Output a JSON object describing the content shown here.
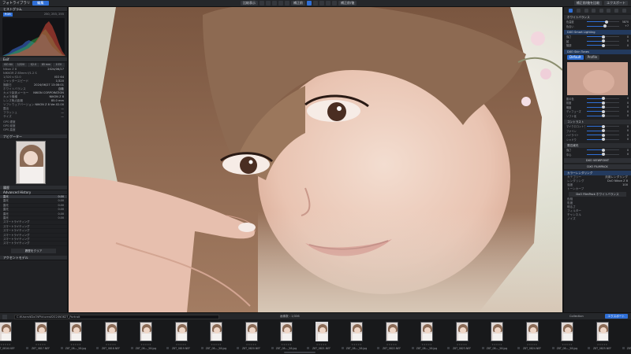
{
  "topbar": {
    "library_label": "フォトライブラリ",
    "edit_label": "編集",
    "compare_label": "比較表示",
    "before_label": "補正前",
    "after_label": "補正前/後",
    "export_label": "エクスポート",
    "ai_label": "補正前/後を比較"
  },
  "left": {
    "histogram_title": "ヒストグラム",
    "rgb_label": "RGB",
    "histo_values": "250, 253, 255",
    "exif_title": "Exif",
    "info_rows": [
      {
        "k": "Nikon Z 8",
        "v": "2024/06/27"
      },
      {
        "k": "NIKKOR Z 85mm f/1.2 S",
        "v": ""
      },
      {
        "k": "1/320 s  f/2.0",
        "v": "ISO 64"
      },
      {
        "k": "シャッタースピード",
        "v": "1/320"
      },
      {
        "k": "撮影日",
        "v": "2024/06/27 13:08:01"
      },
      {
        "k": "ホワイトバランス",
        "v": "自動"
      },
      {
        "k": "カメラ製造メーカー",
        "v": "NIKON CORPORATION"
      },
      {
        "k": "カメラ機種",
        "v": "NIKON Z 8"
      },
      {
        "k": "レンズ焦点距離",
        "v": "85.0 mm"
      },
      {
        "k": "ソフトウェアバージョン",
        "v": "NIKON Z 8 Ver.02.00"
      },
      {
        "k": "露出",
        "v": "—"
      },
      {
        "k": "フラッシュ",
        "v": "—"
      },
      {
        "k": "サイズ",
        "v": "—"
      }
    ],
    "gps_rows": [
      {
        "k": "GPS 緯度",
        "v": ""
      },
      {
        "k": "GPS 経度",
        "v": ""
      },
      {
        "k": "GPS 高度",
        "v": ""
      }
    ],
    "buttons": [
      "ISO 64",
      "1/320",
      "f/2.0",
      "85 mm",
      "0 EV"
    ],
    "thumb_title": "ナビゲーター",
    "history_title": "履歴",
    "history_sub": "Advanced History",
    "history_items": [
      {
        "k": "露光",
        "v": "0.00"
      },
      {
        "k": "露光",
        "v": "0.00"
      },
      {
        "k": "露光",
        "v": "0.00"
      },
      {
        "k": "露光",
        "v": "0.00"
      },
      {
        "k": "露光",
        "v": "0.00"
      },
      {
        "k": "露光",
        "v": "0.00"
      },
      {
        "k": "スマートライティング",
        "v": ""
      },
      {
        "k": "スマートライティング",
        "v": ""
      },
      {
        "k": "スマートライティング",
        "v": ""
      },
      {
        "k": "スマートライティング",
        "v": ""
      },
      {
        "k": "スマートライティング",
        "v": ""
      },
      {
        "k": "スマートライティング",
        "v": ""
      }
    ],
    "reset_label": "履歴をクリア",
    "footer_label": "アクセントモデル"
  },
  "right": {
    "wb_title": "ホワイトバランス",
    "wb_sliders": [
      {
        "label": "色温度",
        "value": "5870",
        "pct": 0.62
      },
      {
        "label": "色合い",
        "value": "+7",
        "pct": 0.55
      }
    ],
    "smart_title": "DXO Smart Lighting",
    "smart_sliders": [
      {
        "label": "強さ",
        "value": "0",
        "pct": 0.5
      },
      {
        "label": "顔",
        "value": "0",
        "pct": 0.5
      },
      {
        "label": "階調",
        "value": "0",
        "pct": 0.5
      }
    ],
    "skin_title": "DXO Skin Tones",
    "skin_tabs": [
      "Default",
      "Profile"
    ],
    "skin_sliders": [
      {
        "label": "肌の色",
        "value": "0",
        "pct": 0.5
      },
      {
        "label": "彩度",
        "value": "0",
        "pct": 0.5
      },
      {
        "label": "明度",
        "value": "0",
        "pct": 0.5
      },
      {
        "label": "ディフューズ",
        "value": "0",
        "pct": 0.5
      },
      {
        "label": "ソフト化",
        "value": "0",
        "pct": 0.5
      }
    ],
    "contrast_title": "コントラスト",
    "contrast_sliders": [
      {
        "label": "マイクロコントラスト",
        "value": "0",
        "pct": 0.5
      },
      {
        "label": "ファイン",
        "value": "0",
        "pct": 0.5
      },
      {
        "label": "ハイライト",
        "value": "0",
        "pct": 0.5
      },
      {
        "label": "シャドウ",
        "value": "0",
        "pct": 0.5
      }
    ],
    "vignetting_title": "周辺減光",
    "vign_sliders": [
      {
        "label": "強さ",
        "value": "0",
        "pct": 0.5
      },
      {
        "label": "中心",
        "value": "0",
        "pct": 0.5
      }
    ],
    "viewpoint_title": "DXO VIEWPOINT",
    "filmpack_title": "DXO FILMPACK",
    "color_title": "カラーレンダリング",
    "color_rows": [
      {
        "k": "カテゴリー",
        "v": "汎用レンダリング"
      },
      {
        "k": "レンダリング",
        "v": "DxO Nikon Z 8"
      },
      {
        "k": "強度",
        "v": "100"
      }
    ],
    "tone_label": "トーンカーブ",
    "tone_btn": "DxO FilmPack ホワイトバランス",
    "misc_rows": [
      "色相",
      "彩度",
      "明るさ",
      "フィルター",
      "チャンネル",
      "ノイズ"
    ]
  },
  "filmbar": {
    "path": "C:¥Users¥DxO¥Pictures¥2024¥0627_Portrait",
    "info": "画像数 : 1/336",
    "collection": "Collection",
    "export": "エクスポート"
  },
  "filmstrip": [
    {
      "name": "Z8T_0816.NEF"
    },
    {
      "name": "Z8T_0817.NEF"
    },
    {
      "name": "Z8T_08—_58.jpg"
    },
    {
      "name": "Z8T_0818.NEF"
    },
    {
      "name": "Z8T_08—_58.jpg"
    },
    {
      "name": "Z8T_0819.NEF"
    },
    {
      "name": "Z8T_08—_58.jpg"
    },
    {
      "name": "Z8T_0820.NEF"
    },
    {
      "name": "Z8T_08—_58.jpg"
    },
    {
      "name": "Z8T_0821.NEF"
    },
    {
      "name": "Z8T_08—_58.jpg"
    },
    {
      "name": "Z8T_0822.NEF"
    },
    {
      "name": "Z8T_08—_58.jpg"
    },
    {
      "name": "Z8T_0823.NEF"
    },
    {
      "name": "Z8T_08—_58.jpg"
    },
    {
      "name": "Z8T_0824.NEF"
    },
    {
      "name": "Z8T_08—_58.jpg"
    },
    {
      "name": "Z8T_0825.NEF"
    },
    {
      "name": "Z8T_08—_58.jpg"
    }
  ],
  "colors": {
    "accent": "#2f6fd6",
    "panel": "#1f2023",
    "bg": "#1a1b1d"
  }
}
